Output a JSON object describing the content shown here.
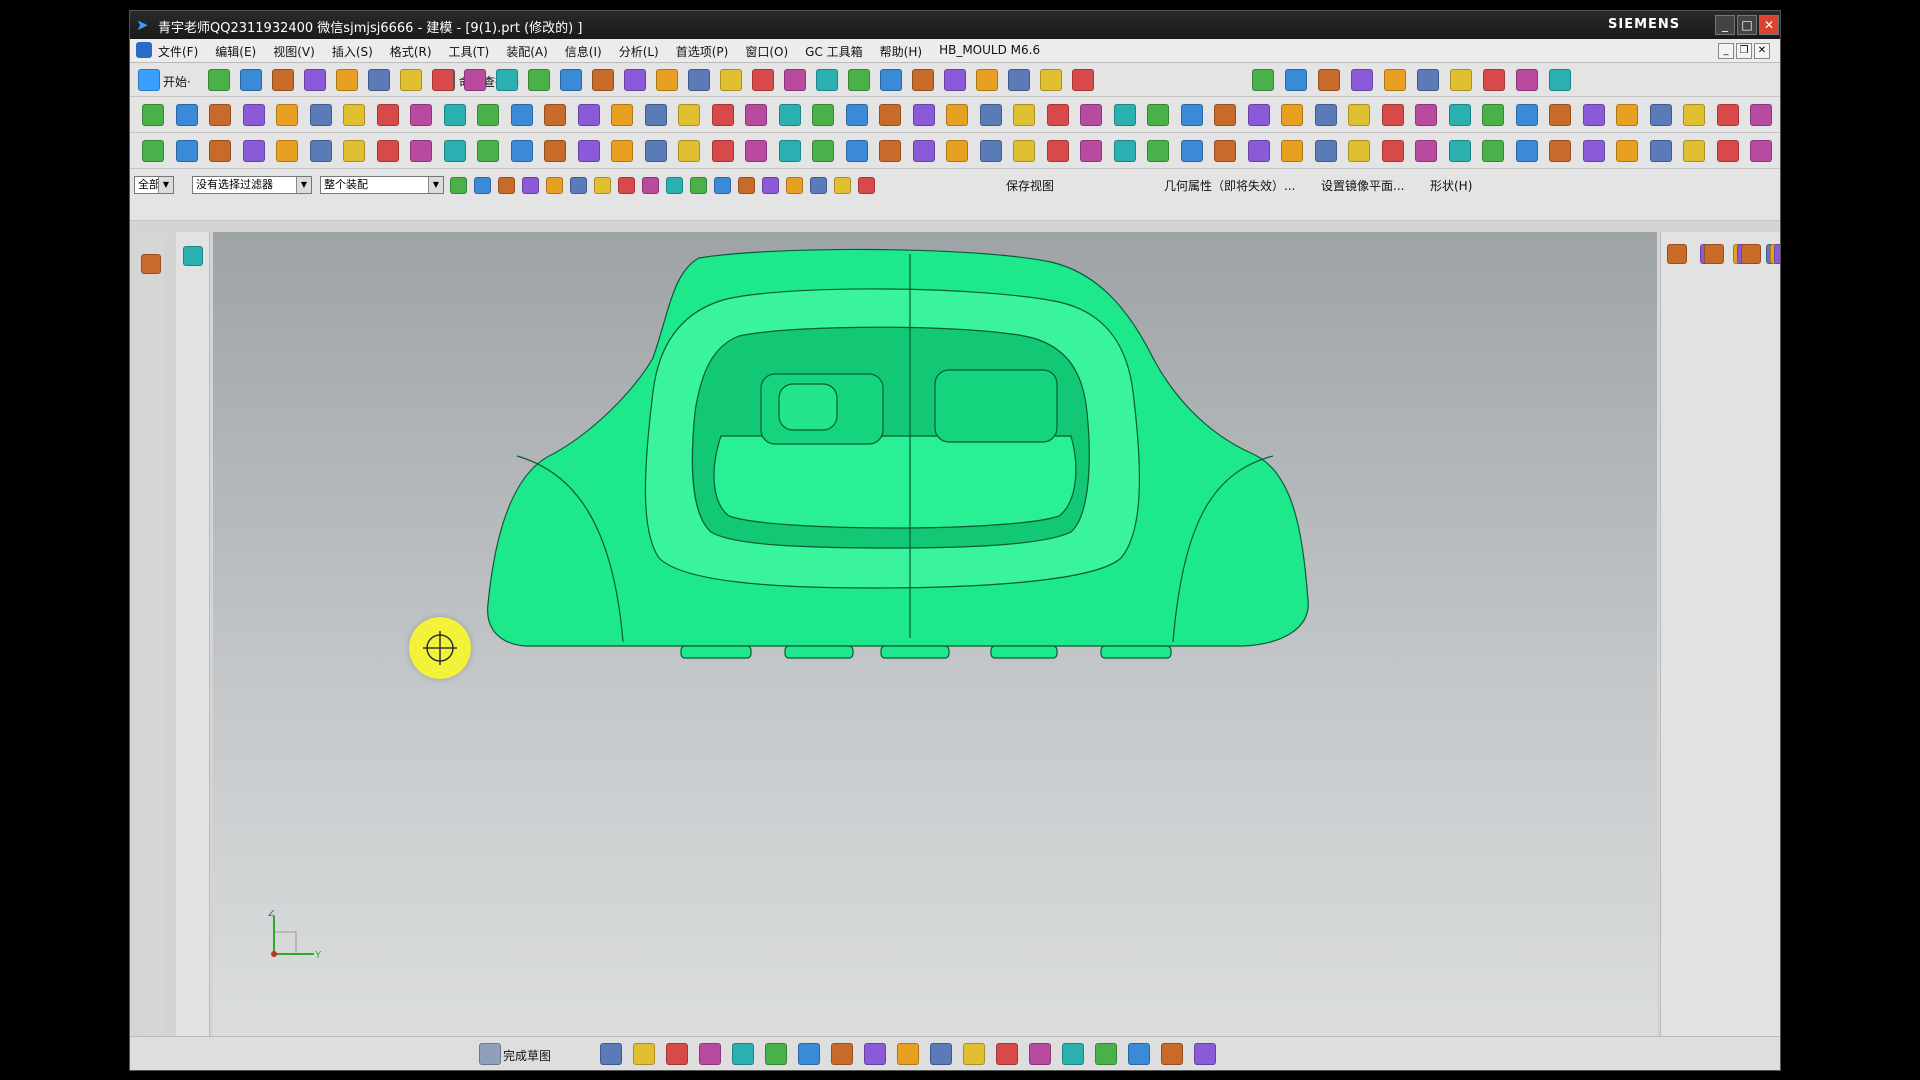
{
  "window": {
    "title": "青宇老师QQ2311932400 微信sjmjsj6666 - 建模 - [9(1).prt  (修改的)  ]",
    "brand": "SIEMENS",
    "minimize": "_",
    "maximize": "□",
    "close": "✕"
  },
  "menu": {
    "items": [
      "文件(F)",
      "编辑(E)",
      "视图(V)",
      "插入(S)",
      "格式(R)",
      "工具(T)",
      "装配(A)",
      "信息(I)",
      "分析(L)",
      "首选项(P)",
      "窗口(O)",
      "GC 工具箱",
      "帮助(H)",
      "HB_MOULD M6.6"
    ]
  },
  "toolbar": {
    "start_label": "开始·",
    "command_finder_label": "命令查找器"
  },
  "selection_bar": {
    "type_filter": "全部",
    "selection_filter": "没有选择过滤器",
    "scope": "整个装配",
    "save_view": "保存视图",
    "geometry_props": "几何属性（即将失效）...",
    "set_mirror_plane": "设置镜像平面...",
    "shape": "形状(H)"
  },
  "sketch_bar": {
    "finish_sketch": "完成草图"
  },
  "model": {
    "color": "#1ee88c",
    "edge_color": "#0a5a37"
  },
  "triad": {
    "z": "Z",
    "y": "Y"
  },
  "colors": {
    "titlebar": "#1f1f1f",
    "accent_close": "#d9432f"
  }
}
